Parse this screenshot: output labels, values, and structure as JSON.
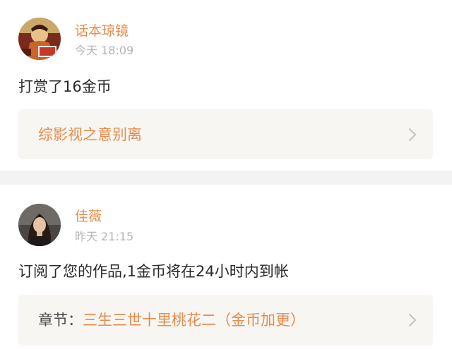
{
  "notifications": [
    {
      "username": "话本琼镜",
      "time": "今天 18:09",
      "message": "打赏了16金币",
      "link_prefix": "",
      "link_title": "综影视之意别离"
    },
    {
      "username": "佳薇",
      "time": "昨天 21:15",
      "message": "订阅了您的作品,1金币将在24小时内到帐",
      "link_prefix": "章节：",
      "link_title": "三生三世十里桃花二（金币加更）"
    }
  ],
  "colors": {
    "accent": "#e98b4a",
    "timestamp": "#b4b4b4",
    "text": "#2a2a2a",
    "link_box_bg": "#f7f6f3",
    "separator": "#f3f3f3"
  },
  "icons": {
    "chevron": "chevron-right-icon"
  }
}
